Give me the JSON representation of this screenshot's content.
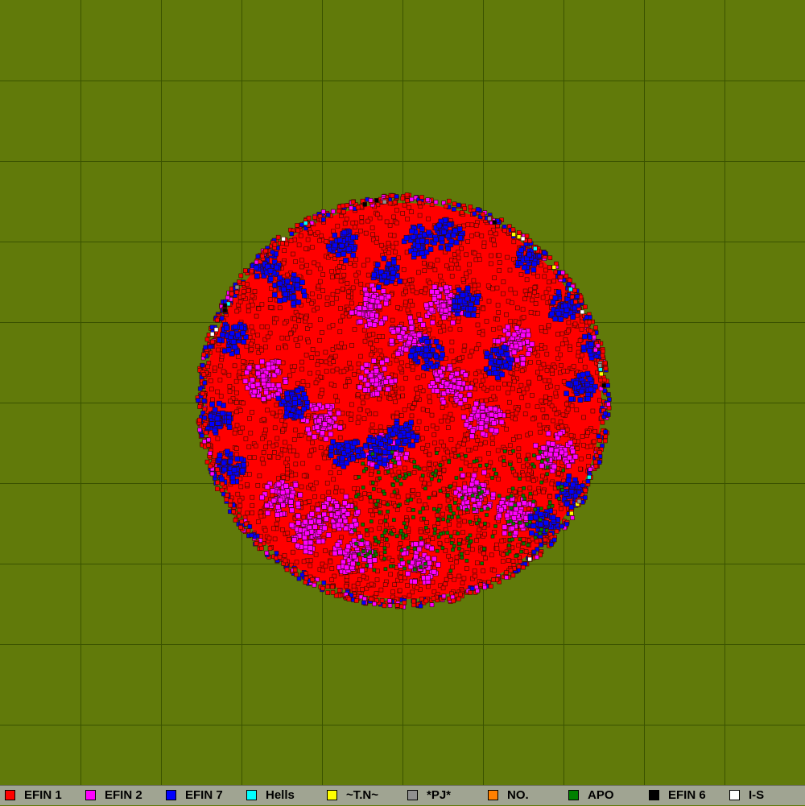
{
  "map": {
    "background_color": "#617a0a",
    "grid_color": "#3a5200",
    "grid_cell_count": 10,
    "blob_outline_color": "#3b0a00"
  },
  "legend": [
    {
      "label": "EFIN 1",
      "color": "#ff0000",
      "share": 0.66
    },
    {
      "label": "EFIN 2",
      "color": "#ff00ff",
      "share": 0.17
    },
    {
      "label": "EFIN 7",
      "color": "#0000ff",
      "share": 0.12
    },
    {
      "label": "Hells",
      "color": "#00ffff",
      "share": 0.004
    },
    {
      "label": "~T.N~",
      "color": "#ffff00",
      "share": 0.004
    },
    {
      "label": "*PJ*",
      "color": "#909090",
      "share": 0.003
    },
    {
      "label": "NO.",
      "color": "#ff8000",
      "share": 0.002
    },
    {
      "label": "APO",
      "color": "#008000",
      "share": 0.03
    },
    {
      "label": "EFIN 6",
      "color": "#000000",
      "share": 0.002
    },
    {
      "label": "I-S",
      "color": "#ffffff",
      "share": 0.002
    }
  ]
}
